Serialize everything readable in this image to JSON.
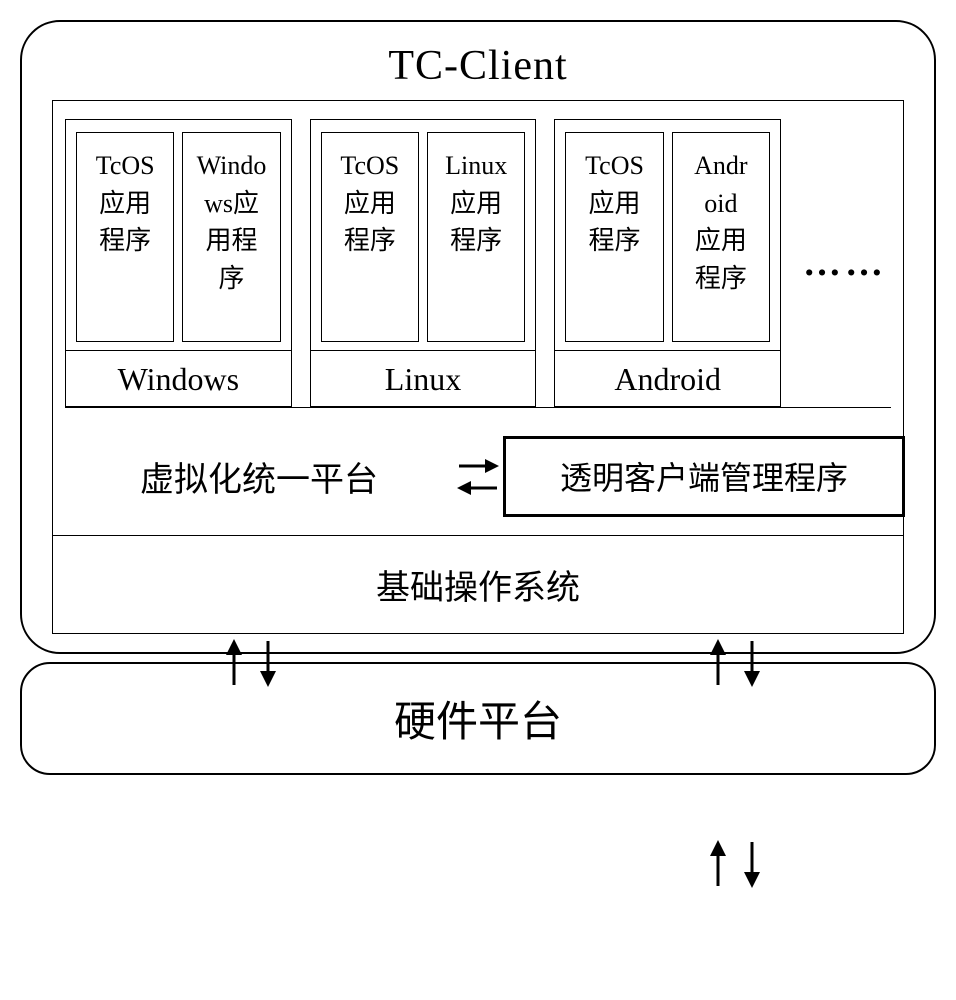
{
  "title": "TC-Client",
  "os": [
    {
      "name": "Windows",
      "apps": [
        "TcOS\n应用\n程序",
        "Windo\nws应\n用程\n序"
      ]
    },
    {
      "name": "Linux",
      "apps": [
        "TcOS\n应用\n程序",
        "Linux\n应用\n程序"
      ]
    },
    {
      "name": "Android",
      "apps": [
        "TcOS\n应用\n程序",
        "Andr\noid\n应用\n程序"
      ]
    }
  ],
  "ellipsis": "……",
  "virtualization_platform": "虚拟化统一平台",
  "client_manager": "透明客户端管理程序",
  "base_os": "基础操作系统",
  "hardware": "硬件平台"
}
